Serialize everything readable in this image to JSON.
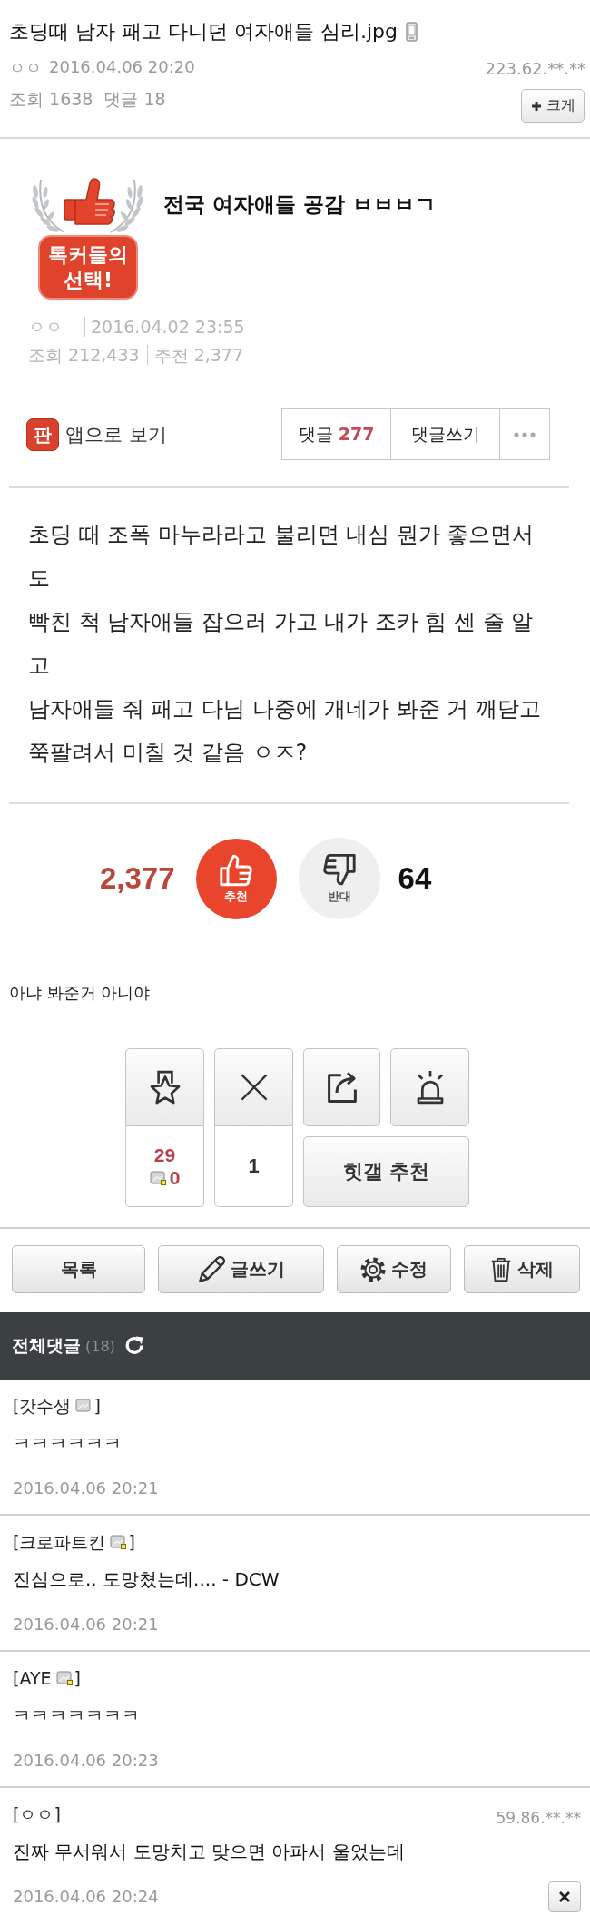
{
  "post_header": {
    "title": "초딩때 남자 패고 다니던 여자애들 심리.jpg",
    "mobile_icon": true,
    "author": "ㅇㅇ",
    "date": "2016.04.06 20:20",
    "ip": "223.62.**.**",
    "views": "조회 1638",
    "comments": "댓글 18",
    "zoom_button": "크게"
  },
  "article": {
    "badge_lines": [
      "톡커들의",
      "선택!"
    ],
    "title": "전국 여자애들 공감 ㅂㅂㅂㄱ",
    "author": "ㅇㅇ",
    "date": "2016.04.02 23:55",
    "views": "조회 212,433",
    "likes": "추천 2,377",
    "app_logo": "판",
    "app_link": "앱으로 보기",
    "buttons": [
      {
        "kind": "comments",
        "label": "댓글",
        "count": "277"
      },
      {
        "kind": "write",
        "label": "댓글쓰기"
      },
      {
        "kind": "more"
      }
    ],
    "body": [
      "초딩 때 조폭 마누라라고 불리면 내심 뭔가 좋으면서도",
      "빡친 척 남자애들 잡으러 가고 내가 조카 힘 센 줄 알고",
      "남자애들 줘 패고 다님 나중에 개네가 봐준 거 깨닫고",
      "쭉팔려서 미칠 것 같음 ㅇㅈ?"
    ],
    "votes": {
      "up_count": "2,377",
      "up_label": "추천",
      "down_label": "반대",
      "down_count": "64"
    }
  },
  "caption": "아냐 봐준거 아니야",
  "action_panel": {
    "recommend_count": "29",
    "member_count": "0",
    "cross_count": "1",
    "hit_button": "힛갤 추천"
  },
  "bottom_buttons": [
    {
      "kind": "list",
      "label": "목록"
    },
    {
      "kind": "write",
      "label": "글쓰기"
    },
    {
      "kind": "edit",
      "label": "수정"
    },
    {
      "kind": "delete",
      "label": "삭제"
    }
  ],
  "comments_header": {
    "title": "전체댓글",
    "count": "(18)"
  },
  "comments": [
    {
      "author": "[갓수생",
      "nick_icon": true,
      "nick_marked": false,
      "author_end": "]",
      "text": "ㅋㅋㅋㅋㅋㅋ",
      "date": "2016.04.06 20:21",
      "deletable": false
    },
    {
      "author": "[크로파트킨",
      "nick_icon": true,
      "nick_marked": true,
      "author_end": "]",
      "text": "진심으로.. 도망쳤는데.... - DCW",
      "date": "2016.04.06 20:21",
      "deletable": false
    },
    {
      "author": "[AYE",
      "nick_icon": true,
      "nick_marked": true,
      "author_end": "]",
      "text": "ㅋㅋㅋㅋㅋㅋㅋ",
      "date": "2016.04.06 20:23",
      "deletable": false
    },
    {
      "author": "[ㅇㅇ]",
      "nick_icon": false,
      "ip": "59.86.**.**",
      "text": "진짜 무서워서 도망치고 맞으면 아파서 울었는데",
      "date": "2016.04.06 20:24",
      "deletable": true
    }
  ]
}
